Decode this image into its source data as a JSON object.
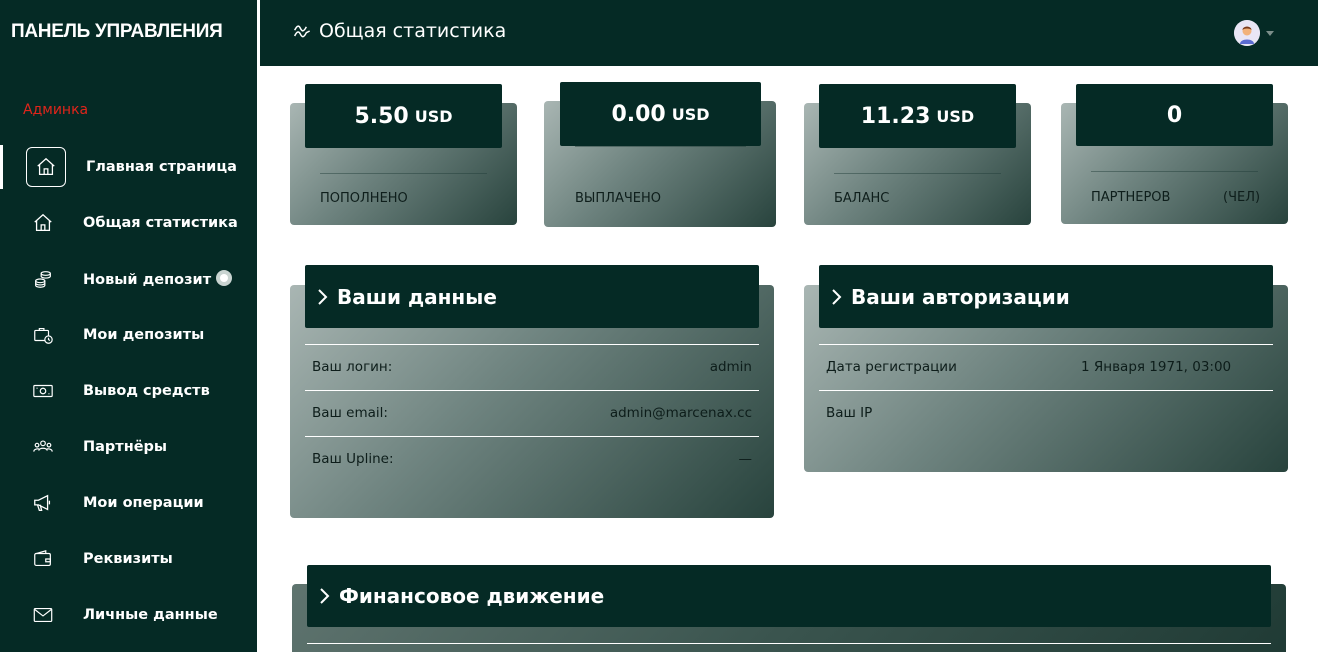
{
  "sidebar": {
    "brand": "ПАНЕЛЬ УПРАВЛЕНИЯ",
    "role": "Админка",
    "items": [
      {
        "label": "Главная страница",
        "icon": "home-icon",
        "active": true
      },
      {
        "label": "Общая статистика",
        "icon": "home-outline-icon"
      },
      {
        "label": "Новый депозит",
        "icon": "coins-icon",
        "badge": true
      },
      {
        "label": "Мои депозиты",
        "icon": "briefcase-clock-icon"
      },
      {
        "label": "Вывод средств",
        "icon": "cash-icon"
      },
      {
        "label": "Партнёры",
        "icon": "users-icon"
      },
      {
        "label": "Мои операции",
        "icon": "megaphone-icon"
      },
      {
        "label": "Реквизиты",
        "icon": "wallet-icon"
      },
      {
        "label": "Личные данные",
        "icon": "mail-icon"
      }
    ]
  },
  "header": {
    "title": "Общая статистика",
    "title_icon": "activity-icon",
    "avatar_icon": "user-avatar-icon"
  },
  "stats": [
    {
      "value": "5.50",
      "currency": "USD",
      "label": "ПОПОЛНЕНО"
    },
    {
      "value": "0.00",
      "currency": "USD",
      "label": "ВЫПЛАЧЕНО"
    },
    {
      "value": "11.23",
      "currency": "USD",
      "label": "БАЛАНС"
    },
    {
      "value": "0",
      "currency": "",
      "label": "ПАРТНЕРОВ",
      "unit": "(ЧЕЛ)"
    }
  ],
  "your_data": {
    "title": "Ваши данные",
    "rows": [
      {
        "label": "Ваш логин:",
        "value": "admin"
      },
      {
        "label": "Ваш email:",
        "value": "admin@marcenax.cc"
      },
      {
        "label": "Ваш Upline:",
        "value": "—"
      }
    ]
  },
  "your_auth": {
    "title": "Ваши авторизации",
    "rows": [
      {
        "label": "Дата регистрации",
        "value": "1 Января 1971, 03:00"
      },
      {
        "label": "Ваш IP",
        "value": ""
      }
    ]
  },
  "finance": {
    "title": "Финансовое движение"
  },
  "colors": {
    "sidebar_bg": "#052a25",
    "accent_red": "#e0251b",
    "card_dark": "#052a25"
  }
}
